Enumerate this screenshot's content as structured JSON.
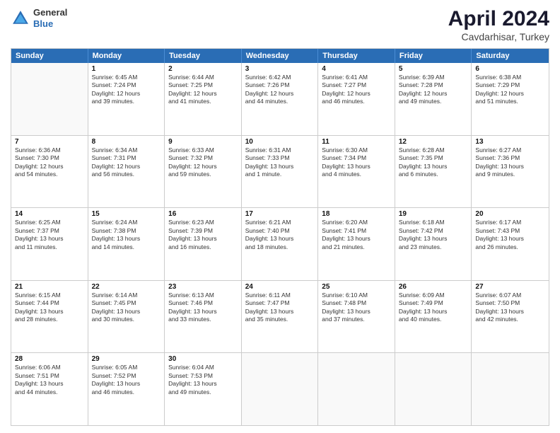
{
  "header": {
    "logo_general": "General",
    "logo_blue": "Blue",
    "month": "April 2024",
    "location": "Cavdarhisar, Turkey"
  },
  "days_of_week": [
    "Sunday",
    "Monday",
    "Tuesday",
    "Wednesday",
    "Thursday",
    "Friday",
    "Saturday"
  ],
  "rows": [
    [
      {
        "empty": true
      },
      {
        "day": "1",
        "lines": [
          "Sunrise: 6:45 AM",
          "Sunset: 7:24 PM",
          "Daylight: 12 hours",
          "and 39 minutes."
        ]
      },
      {
        "day": "2",
        "lines": [
          "Sunrise: 6:44 AM",
          "Sunset: 7:25 PM",
          "Daylight: 12 hours",
          "and 41 minutes."
        ]
      },
      {
        "day": "3",
        "lines": [
          "Sunrise: 6:42 AM",
          "Sunset: 7:26 PM",
          "Daylight: 12 hours",
          "and 44 minutes."
        ]
      },
      {
        "day": "4",
        "lines": [
          "Sunrise: 6:41 AM",
          "Sunset: 7:27 PM",
          "Daylight: 12 hours",
          "and 46 minutes."
        ]
      },
      {
        "day": "5",
        "lines": [
          "Sunrise: 6:39 AM",
          "Sunset: 7:28 PM",
          "Daylight: 12 hours",
          "and 49 minutes."
        ]
      },
      {
        "day": "6",
        "lines": [
          "Sunrise: 6:38 AM",
          "Sunset: 7:29 PM",
          "Daylight: 12 hours",
          "and 51 minutes."
        ]
      }
    ],
    [
      {
        "day": "7",
        "lines": [
          "Sunrise: 6:36 AM",
          "Sunset: 7:30 PM",
          "Daylight: 12 hours",
          "and 54 minutes."
        ]
      },
      {
        "day": "8",
        "lines": [
          "Sunrise: 6:34 AM",
          "Sunset: 7:31 PM",
          "Daylight: 12 hours",
          "and 56 minutes."
        ]
      },
      {
        "day": "9",
        "lines": [
          "Sunrise: 6:33 AM",
          "Sunset: 7:32 PM",
          "Daylight: 12 hours",
          "and 59 minutes."
        ]
      },
      {
        "day": "10",
        "lines": [
          "Sunrise: 6:31 AM",
          "Sunset: 7:33 PM",
          "Daylight: 13 hours",
          "and 1 minute."
        ]
      },
      {
        "day": "11",
        "lines": [
          "Sunrise: 6:30 AM",
          "Sunset: 7:34 PM",
          "Daylight: 13 hours",
          "and 4 minutes."
        ]
      },
      {
        "day": "12",
        "lines": [
          "Sunrise: 6:28 AM",
          "Sunset: 7:35 PM",
          "Daylight: 13 hours",
          "and 6 minutes."
        ]
      },
      {
        "day": "13",
        "lines": [
          "Sunrise: 6:27 AM",
          "Sunset: 7:36 PM",
          "Daylight: 13 hours",
          "and 9 minutes."
        ]
      }
    ],
    [
      {
        "day": "14",
        "lines": [
          "Sunrise: 6:25 AM",
          "Sunset: 7:37 PM",
          "Daylight: 13 hours",
          "and 11 minutes."
        ]
      },
      {
        "day": "15",
        "lines": [
          "Sunrise: 6:24 AM",
          "Sunset: 7:38 PM",
          "Daylight: 13 hours",
          "and 14 minutes."
        ]
      },
      {
        "day": "16",
        "lines": [
          "Sunrise: 6:23 AM",
          "Sunset: 7:39 PM",
          "Daylight: 13 hours",
          "and 16 minutes."
        ]
      },
      {
        "day": "17",
        "lines": [
          "Sunrise: 6:21 AM",
          "Sunset: 7:40 PM",
          "Daylight: 13 hours",
          "and 18 minutes."
        ]
      },
      {
        "day": "18",
        "lines": [
          "Sunrise: 6:20 AM",
          "Sunset: 7:41 PM",
          "Daylight: 13 hours",
          "and 21 minutes."
        ]
      },
      {
        "day": "19",
        "lines": [
          "Sunrise: 6:18 AM",
          "Sunset: 7:42 PM",
          "Daylight: 13 hours",
          "and 23 minutes."
        ]
      },
      {
        "day": "20",
        "lines": [
          "Sunrise: 6:17 AM",
          "Sunset: 7:43 PM",
          "Daylight: 13 hours",
          "and 26 minutes."
        ]
      }
    ],
    [
      {
        "day": "21",
        "lines": [
          "Sunrise: 6:15 AM",
          "Sunset: 7:44 PM",
          "Daylight: 13 hours",
          "and 28 minutes."
        ]
      },
      {
        "day": "22",
        "lines": [
          "Sunrise: 6:14 AM",
          "Sunset: 7:45 PM",
          "Daylight: 13 hours",
          "and 30 minutes."
        ]
      },
      {
        "day": "23",
        "lines": [
          "Sunrise: 6:13 AM",
          "Sunset: 7:46 PM",
          "Daylight: 13 hours",
          "and 33 minutes."
        ]
      },
      {
        "day": "24",
        "lines": [
          "Sunrise: 6:11 AM",
          "Sunset: 7:47 PM",
          "Daylight: 13 hours",
          "and 35 minutes."
        ]
      },
      {
        "day": "25",
        "lines": [
          "Sunrise: 6:10 AM",
          "Sunset: 7:48 PM",
          "Daylight: 13 hours",
          "and 37 minutes."
        ]
      },
      {
        "day": "26",
        "lines": [
          "Sunrise: 6:09 AM",
          "Sunset: 7:49 PM",
          "Daylight: 13 hours",
          "and 40 minutes."
        ]
      },
      {
        "day": "27",
        "lines": [
          "Sunrise: 6:07 AM",
          "Sunset: 7:50 PM",
          "Daylight: 13 hours",
          "and 42 minutes."
        ]
      }
    ],
    [
      {
        "day": "28",
        "lines": [
          "Sunrise: 6:06 AM",
          "Sunset: 7:51 PM",
          "Daylight: 13 hours",
          "and 44 minutes."
        ]
      },
      {
        "day": "29",
        "lines": [
          "Sunrise: 6:05 AM",
          "Sunset: 7:52 PM",
          "Daylight: 13 hours",
          "and 46 minutes."
        ]
      },
      {
        "day": "30",
        "lines": [
          "Sunrise: 6:04 AM",
          "Sunset: 7:53 PM",
          "Daylight: 13 hours",
          "and 49 minutes."
        ]
      },
      {
        "empty": true
      },
      {
        "empty": true
      },
      {
        "empty": true
      },
      {
        "empty": true
      }
    ]
  ]
}
